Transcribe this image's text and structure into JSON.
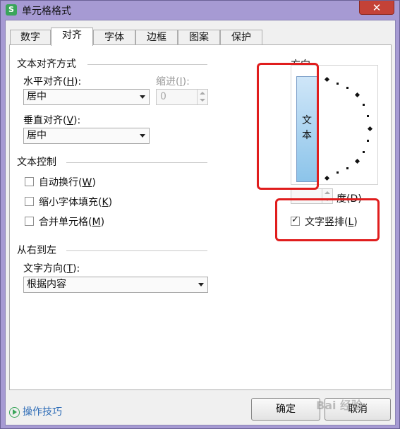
{
  "window": {
    "title": "单元格格式",
    "app_icon": "S"
  },
  "tabs": [
    {
      "label": "数字"
    },
    {
      "label": "对齐"
    },
    {
      "label": "字体"
    },
    {
      "label": "边框"
    },
    {
      "label": "图案"
    },
    {
      "label": "保护"
    }
  ],
  "alignment": {
    "section_title": "文本对齐方式",
    "horizontal_label": "水平对齐(",
    "horizontal_key": "H",
    "horizontal_suffix": "):",
    "horizontal_value": "居中",
    "indent_label": "缩进(",
    "indent_key": "I",
    "indent_suffix": "):",
    "indent_value": "0",
    "vertical_label": "垂直对齐(",
    "vertical_key": "V",
    "vertical_suffix": "):",
    "vertical_value": "居中"
  },
  "text_control": {
    "section_title": "文本控制",
    "wrap_label": "自动换行(",
    "wrap_key": "W",
    "shrink_label": "缩小字体填充(",
    "shrink_key": "K",
    "merge_label": "合并单元格(",
    "merge_key": "M",
    "close_paren": ")"
  },
  "rtl": {
    "section_title": "从右到左",
    "direction_label": "文字方向(",
    "direction_key": "T",
    "direction_suffix": "):",
    "direction_value": "根据内容"
  },
  "orientation": {
    "title": "方向",
    "vertical_text_1": "文",
    "vertical_text_2": "本",
    "degree_label": "度(D)",
    "vertical_checkbox_label": "文字竖排(",
    "vertical_checkbox_key": "L",
    "vertical_checked": true
  },
  "footer": {
    "tips_label": "操作技巧",
    "ok_label": "确定",
    "cancel_label": "取消",
    "watermark": "Bai 经验"
  },
  "colors": {
    "highlight": "#e01d1d",
    "accent": "#2f6db7"
  },
  "icons": [
    "app-icon",
    "close-icon",
    "dropdown-arrow-icon",
    "spin-up-icon",
    "spin-down-icon",
    "play-circle-icon",
    "checkmark-icon"
  ]
}
